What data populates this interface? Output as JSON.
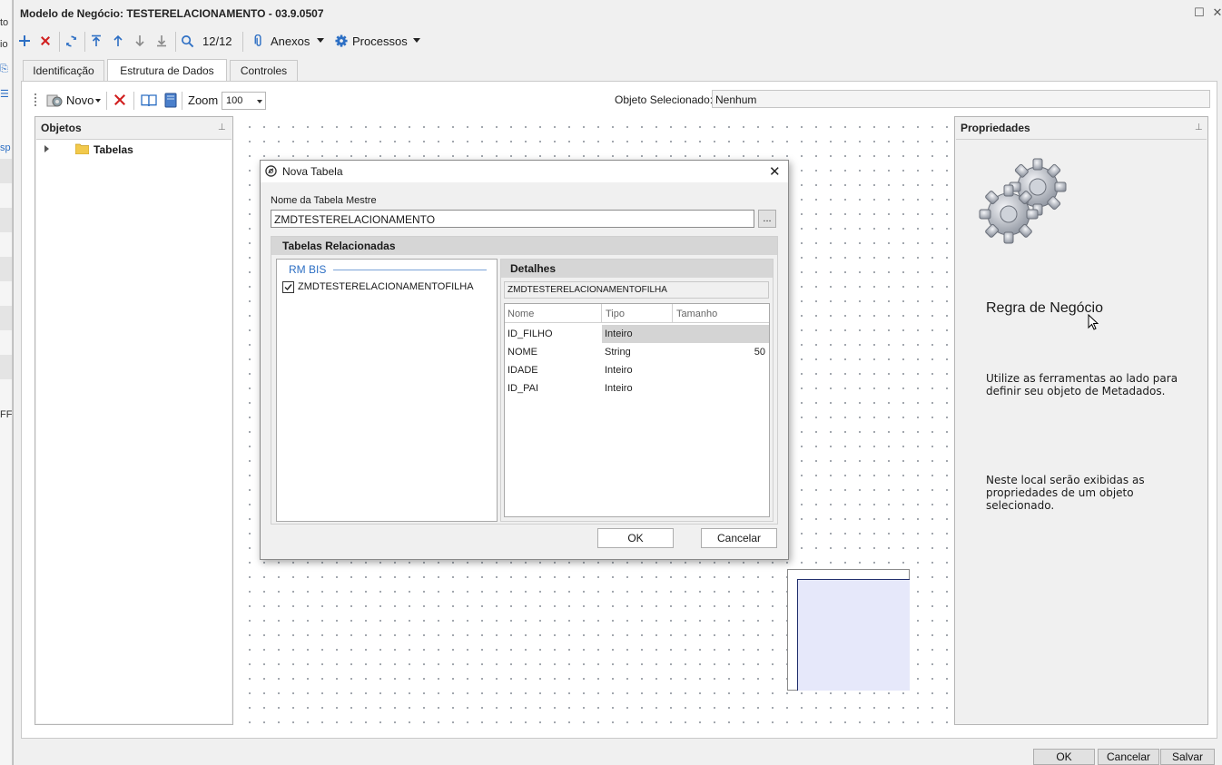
{
  "background_window": {
    "cut_labels": [
      "to",
      "io",
      "sp",
      "FF"
    ]
  },
  "window": {
    "title": "Modelo de Negócio: TESTERELACIONAMENTO - 03.9.0507",
    "restore_glyph": "☐",
    "close_glyph": "✕"
  },
  "toolbar": {
    "record_counter": "12/12",
    "attachments_label": "Anexos",
    "processes_label": "Processos",
    "icons": [
      "add-icon",
      "delete-icon",
      "refresh-icon",
      "first-record-icon",
      "previous-record-icon",
      "next-record-icon",
      "last-record-icon",
      "search-icon",
      "paperclip-icon",
      "gear-icon"
    ]
  },
  "tabs": [
    {
      "label": "Identificação",
      "active": false
    },
    {
      "label": "Estrutura de Dados",
      "active": true
    },
    {
      "label": "Controles",
      "active": false
    }
  ],
  "inner_toolbar": {
    "new_label": "Novo",
    "zoom_label": "Zoom",
    "zoom_value": "100",
    "selected_object_label": "Objeto Selecionado:",
    "selected_object_value": "Nenhum"
  },
  "objects_panel": {
    "title": "Objetos",
    "pin_glyph": "⊥",
    "tree_root": "Tabelas"
  },
  "properties_panel": {
    "title": "Propriedades",
    "pin_glyph": "⊥",
    "heading": "Regra de Negócio",
    "hint_1": "Utilize as ferramentas ao lado para definir seu objeto de Metadados.",
    "hint_2": "Neste local serão exibidas as propriedades de um objeto selecionado."
  },
  "bottom_buttons": {
    "ok": "OK",
    "cancel": "Cancelar",
    "save": "Salvar"
  },
  "dialog": {
    "title": "Nova Tabela",
    "close_glyph": "✕",
    "master_table_label": "Nome da Tabela Mestre",
    "master_table_value": "ZMDTESTERELACIONAMENTO",
    "browse_label": "...",
    "related_tables_header": "Tabelas Relacionadas",
    "group_label": "RM BIS",
    "related_tables": [
      {
        "name": "ZMDTESTERELACIONAMENTOFILHA",
        "checked": true
      }
    ],
    "details": {
      "header": "Detalhes",
      "table_name": "ZMDTESTERELACIONAMENTOFILHA",
      "columns": [
        "Nome",
        "Tipo",
        "Tamanho"
      ],
      "rows": [
        {
          "nome": "ID_FILHO",
          "tipo": "Inteiro",
          "tamanho": ""
        },
        {
          "nome": "NOME",
          "tipo": "String",
          "tamanho": "50"
        },
        {
          "nome": "IDADE",
          "tipo": "Inteiro",
          "tamanho": ""
        },
        {
          "nome": "ID_PAI",
          "tipo": "Inteiro",
          "tamanho": ""
        }
      ]
    },
    "ok_label": "OK",
    "cancel_label": "Cancelar"
  },
  "colors": {
    "accent_blue": "#2d6fc4",
    "delete_red": "#d11f1f",
    "grid_highlight": "#d4d4d4",
    "shape_fill": "#e6e8fa",
    "shape_border": "#1f2d6b"
  }
}
